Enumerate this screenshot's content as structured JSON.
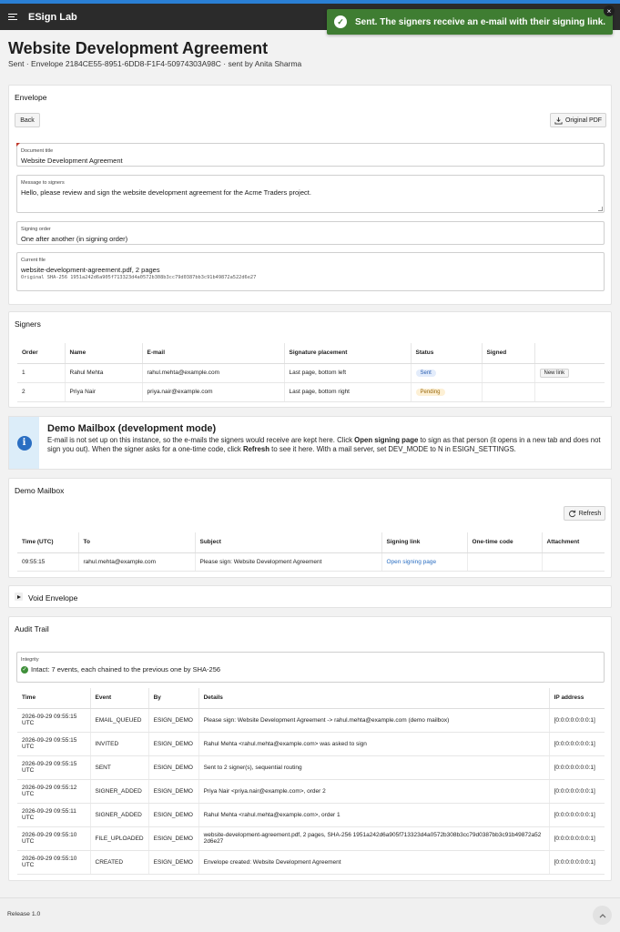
{
  "app": {
    "title": "ESign Lab"
  },
  "toast": {
    "message": "Sent. The signers receive an e-mail with their signing link.",
    "close": "×"
  },
  "page": {
    "title": "Website Development Agreement",
    "subtitle": "Sent · Envelope 2184CE55-8951-6DD8-F1F4-50974303A98C · sent by Anita Sharma"
  },
  "envelope": {
    "title": "Envelope",
    "back_label": "Back",
    "pdf_label": "Original PDF",
    "fields": {
      "doc_title_label": "Document title",
      "doc_title_value": "Website Development Agreement",
      "message_label": "Message to signers",
      "message_value": "Hello, please review and sign the website development agreement for the Acme Traders project.",
      "order_label": "Signing order",
      "order_value": "One after another (in signing order)",
      "file_label": "Current file",
      "file_value": "website-development-agreement.pdf, 2 pages",
      "file_hash": "Original SHA-256 1951a242d6a905f713323d4a0572b308b3cc79d0387bb3c91b49872a522d6e27"
    }
  },
  "signers": {
    "title": "Signers",
    "columns": [
      "Order",
      "Name",
      "E-mail",
      "Signature placement",
      "Status",
      "Signed",
      ""
    ],
    "rows": [
      {
        "order": "1",
        "name": "Rahul Mehta",
        "email": "rahul.mehta@example.com",
        "placement": "Last page, bottom left",
        "status": "Sent",
        "signed": "",
        "action": "New link"
      },
      {
        "order": "2",
        "name": "Priya Nair",
        "email": "priya.nair@example.com",
        "placement": "Last page, bottom right",
        "status": "Pending",
        "signed": "",
        "action": ""
      }
    ]
  },
  "info": {
    "title": "Demo Mailbox (development mode)",
    "body_1": "E-mail is not set up on this instance, so the e-mails the signers would receive are kept here. Click ",
    "bold_1": "Open signing page",
    "body_2": " to sign as that person (it opens in a new tab and does not sign you out). When the signer asks for a one-time code, click ",
    "bold_2": "Refresh",
    "body_3": " to see it here. With a mail server, set DEV_MODE to N in ESIGN_SETTINGS."
  },
  "mailbox": {
    "title": "Demo Mailbox",
    "refresh_label": "Refresh",
    "columns": [
      "Time (UTC)",
      "To",
      "Subject",
      "Signing link",
      "One-time code",
      "Attachment"
    ],
    "rows": [
      {
        "time": "09:55:15",
        "to": "rahul.mehta@example.com",
        "subject": "Please sign: Website Development Agreement",
        "link": "Open signing page",
        "code": "",
        "attachment": ""
      }
    ]
  },
  "void": {
    "title": "Void Envelope"
  },
  "audit": {
    "title": "Audit Trail",
    "integrity_label": "Integrity",
    "integrity_value": "Intact: 7 events, each chained to the previous one by SHA-256",
    "columns": [
      "Time",
      "Event",
      "By",
      "Details",
      "IP address"
    ],
    "rows": [
      {
        "time": "2026-09-29 09:55:15 UTC",
        "event": "EMAIL_QUEUED",
        "by": "ESIGN_DEMO",
        "details": "Please sign: Website Development Agreement -> rahul.mehta@example.com (demo mailbox)",
        "ip": "[0:0:0:0:0:0:0:1]"
      },
      {
        "time": "2026-09-29 09:55:15 UTC",
        "event": "INVITED",
        "by": "ESIGN_DEMO",
        "details": "Rahul Mehta <rahul.mehta@example.com> was asked to sign",
        "ip": "[0:0:0:0:0:0:0:1]"
      },
      {
        "time": "2026-09-29 09:55:15 UTC",
        "event": "SENT",
        "by": "ESIGN_DEMO",
        "details": "Sent to 2 signer(s), sequential routing",
        "ip": "[0:0:0:0:0:0:0:1]"
      },
      {
        "time": "2026-09-29 09:55:12 UTC",
        "event": "SIGNER_ADDED",
        "by": "ESIGN_DEMO",
        "details": "Priya Nair <priya.nair@example.com>, order 2",
        "ip": "[0:0:0:0:0:0:0:1]"
      },
      {
        "time": "2026-09-29 09:55:11 UTC",
        "event": "SIGNER_ADDED",
        "by": "ESIGN_DEMO",
        "details": "Rahul Mehta <rahul.mehta@example.com>, order 1",
        "ip": "[0:0:0:0:0:0:0:1]"
      },
      {
        "time": "2026-09-29 09:55:10 UTC",
        "event": "FILE_UPLOADED",
        "by": "ESIGN_DEMO",
        "details": "website-development-agreement.pdf, 2 pages, SHA-256 1951a242d6a905f713323d4a0572b308b3cc79d0387bb3c91b49872a522d6e27",
        "ip": "[0:0:0:0:0:0:0:1]"
      },
      {
        "time": "2026-09-29 09:55:10 UTC",
        "event": "CREATED",
        "by": "ESIGN_DEMO",
        "details": "Envelope created: Website Development Agreement",
        "ip": "[0:0:0:0:0:0:0:1]"
      }
    ]
  },
  "footer": {
    "release": "Release 1.0"
  },
  "colors": {
    "brand_bar": "#2b2b2b",
    "accent": "#2a7fd4",
    "toast": "#3f7d32",
    "link": "#2a6ec2"
  }
}
